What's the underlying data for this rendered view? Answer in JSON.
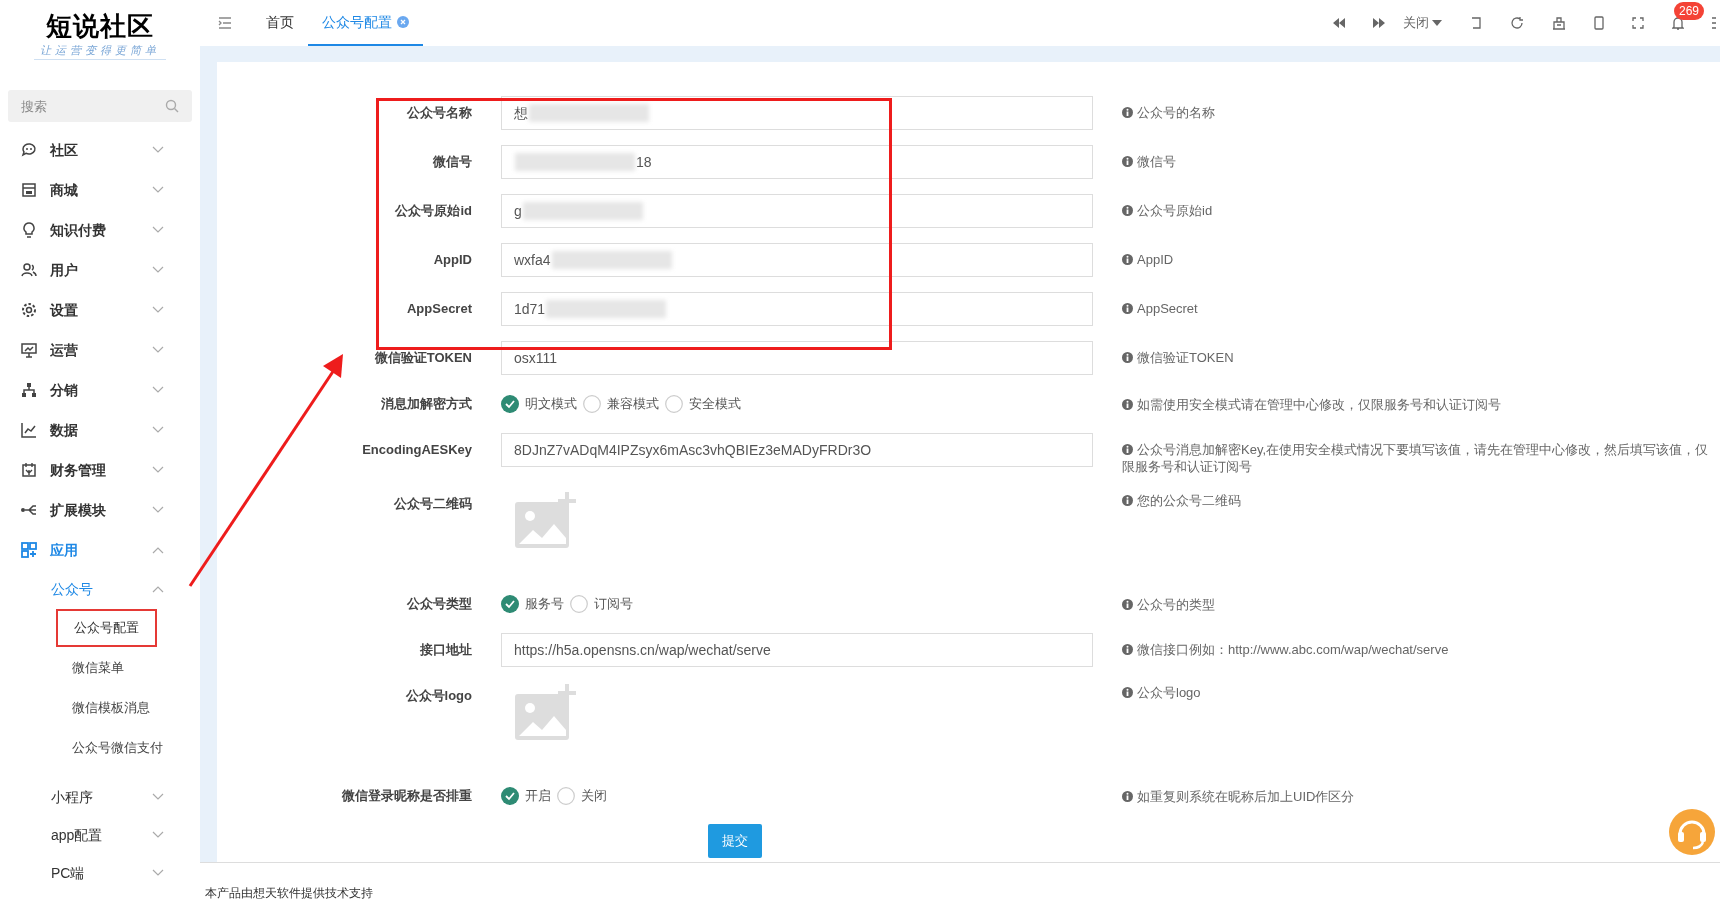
{
  "sidebar": {
    "logo": {
      "title": "短说社区",
      "slogan": "让运营变得更简单"
    },
    "search": {
      "placeholder": "搜索"
    },
    "items": [
      {
        "label": "社区",
        "expanded": false,
        "selected": false
      },
      {
        "label": "商城",
        "expanded": false,
        "selected": false
      },
      {
        "label": "知识付费",
        "expanded": false,
        "selected": false
      },
      {
        "label": "用户",
        "expanded": false,
        "selected": false
      },
      {
        "label": "设置",
        "expanded": false,
        "selected": false
      },
      {
        "label": "运营",
        "expanded": false,
        "selected": false
      },
      {
        "label": "分销",
        "expanded": false,
        "selected": false
      },
      {
        "label": "数据",
        "expanded": false,
        "selected": false
      },
      {
        "label": "财务管理",
        "expanded": false,
        "selected": false
      },
      {
        "label": "扩展模块",
        "expanded": false,
        "selected": false
      },
      {
        "label": "应用",
        "expanded": true,
        "selected": true,
        "children": [
          {
            "label": "公众号",
            "expanded": true,
            "selected": true,
            "children": [
              {
                "label": "公众号配置",
                "selected": true
              },
              {
                "label": "微信菜单",
                "selected": false
              },
              {
                "label": "微信模板消息",
                "selected": false
              },
              {
                "label": "公众号微信支付",
                "selected": false
              }
            ]
          },
          {
            "label": "小程序",
            "expanded": false,
            "selected": false
          },
          {
            "label": "app配置",
            "expanded": false,
            "selected": false
          },
          {
            "label": "PC端",
            "expanded": false,
            "selected": false
          }
        ]
      }
    ]
  },
  "tabs": [
    {
      "label": "首页",
      "selected": false,
      "closable": false
    },
    {
      "label": "公众号配置",
      "selected": true,
      "closable": true
    }
  ],
  "toolbar": {
    "close_menu": "关闭",
    "notifications": "269"
  },
  "form": {
    "fields": [
      {
        "kind": "text",
        "label": "公众号名称",
        "value_prefix": "想",
        "redacted": true,
        "hint": "公众号的名称"
      },
      {
        "kind": "text",
        "label": "微信号",
        "value_suffix": "18",
        "redacted": true,
        "hint": "微信号"
      },
      {
        "kind": "text",
        "label": "公众号原始id",
        "value_prefix": "g",
        "redacted": true,
        "hint": "公众号原始id"
      },
      {
        "kind": "text",
        "label": "AppID",
        "value_prefix": "wxfa4",
        "redacted": true,
        "hint": "AppID"
      },
      {
        "kind": "text",
        "label": "AppSecret",
        "value_prefix": "1d71",
        "redacted": true,
        "hint": "AppSecret"
      },
      {
        "kind": "text",
        "label": "微信验证TOKEN",
        "value_prefix": "osx111",
        "redacted": false,
        "hint": "微信验证TOKEN"
      },
      {
        "kind": "radio",
        "label": "消息加解密方式",
        "options": [
          {
            "label": "明文模式",
            "selected": true
          },
          {
            "label": "兼容模式",
            "selected": false
          },
          {
            "label": "安全模式",
            "selected": false
          }
        ],
        "hint": "如需使用安全模式请在管理中心修改，仅限服务号和认证订阅号"
      },
      {
        "kind": "text",
        "label": "EncodingAESKey",
        "value_prefix": "8DJnZ7vADqM4IPZsyx6mAsc3vhQBIEz3eMADyFRDr3O",
        "redacted": false,
        "hint": "公众号消息加解密Key,在使用安全模式情况下要填写该值，请先在管理中心修改，然后填写该值，仅限服务号和认证订阅号"
      },
      {
        "kind": "image",
        "label": "公众号二维码",
        "hint": "您的公众号二维码"
      },
      {
        "kind": "radio",
        "label": "公众号类型",
        "options": [
          {
            "label": "服务号",
            "selected": true
          },
          {
            "label": "订阅号",
            "selected": false
          }
        ],
        "hint": "公众号的类型"
      },
      {
        "kind": "text",
        "label": "接口地址",
        "value_prefix": "https://h5a.opensns.cn/wap/wechat/serve",
        "redacted": false,
        "hint": "微信接口例如：http://www.abc.com/wap/wechat/serve"
      },
      {
        "kind": "image",
        "label": "公众号logo",
        "hint": "公众号logo"
      },
      {
        "kind": "radio",
        "label": "微信登录昵称是否排重",
        "options": [
          {
            "label": "开启",
            "selected": true
          },
          {
            "label": "关闭",
            "selected": false
          }
        ],
        "hint": "如重复则系统在昵称后加上UID作区分"
      }
    ],
    "submit": "提交"
  },
  "footer": "本产品由想天软件提供技术支持"
}
